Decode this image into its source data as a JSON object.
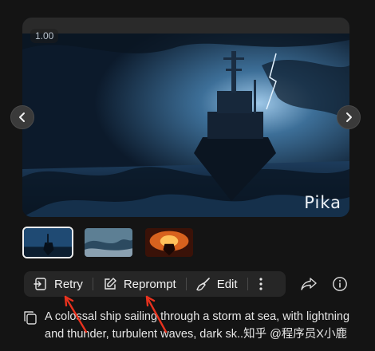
{
  "viewer": {
    "timestamp": "1.00",
    "watermark": "Pika"
  },
  "icons": {
    "prev": "chevron-left-icon",
    "next": "chevron-right-icon",
    "retry": "retry-icon",
    "reprompt": "edit-pencil-icon",
    "edit": "brush-icon",
    "more": "more-vertical-icon",
    "share": "share-icon",
    "info": "info-icon",
    "copy": "copy-icon"
  },
  "thumbnails": [
    {
      "selected": true
    },
    {
      "selected": false
    },
    {
      "selected": false
    }
  ],
  "toolbar": {
    "retry_label": "Retry",
    "reprompt_label": "Reprompt",
    "edit_label": "Edit"
  },
  "prompt": {
    "text": "A colossal ship sailing through a storm at sea, with lightning and thunder, turbulent waves, dark sk..知乎 @程序员X小鹿"
  },
  "colors": {
    "background": "#141414",
    "toolbar": "#262626",
    "annotation_arrow": "#e8321e"
  }
}
